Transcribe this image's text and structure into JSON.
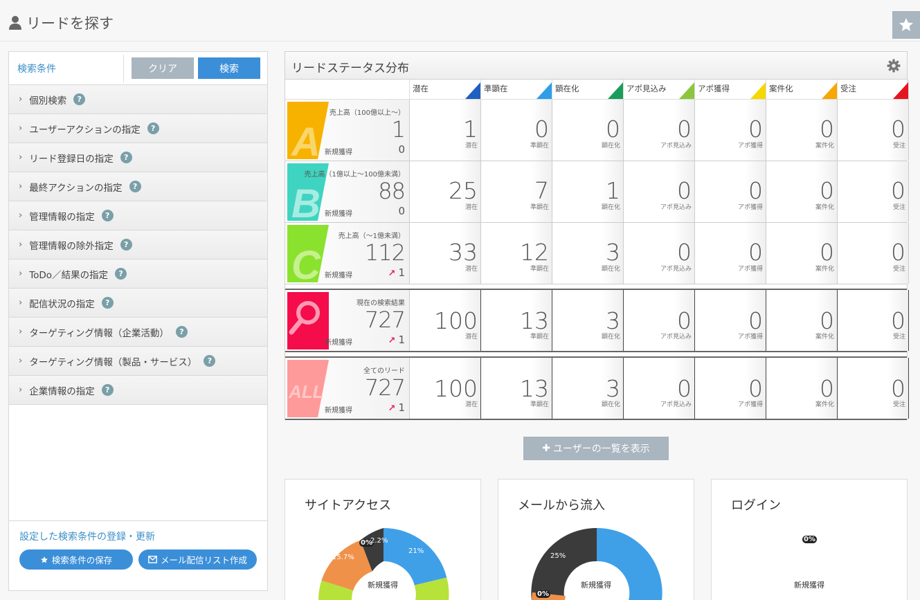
{
  "page": {
    "title": "リードを探す"
  },
  "search": {
    "label": "検索条件",
    "clear": "クリア",
    "search": "検索",
    "items": [
      "個別検索",
      "ユーザーアクションの指定",
      "リード登録日の指定",
      "最終アクションの指定",
      "管理情報の指定",
      "管理情報の除外指定",
      "ToDo／結果の指定",
      "配信状況の指定",
      "ターゲティング情報（企業活動）",
      "ターゲティング情報（製品・サービス）",
      "企業情報の指定"
    ],
    "help": "?",
    "footer_link": "設定した検索条件の登録・更新",
    "save": "検索条件の保存",
    "mail_list": "メール配信リスト作成"
  },
  "status": {
    "title": "リードステータス分布",
    "columns": [
      "潜在",
      "準顕在",
      "顕在化",
      "アポ見込み",
      "アポ獲得",
      "案件化",
      "受注"
    ],
    "column_colors": [
      "#1f5fbf",
      "#2e9ee6",
      "#1a9d5a",
      "#8cc63e",
      "#f5d800",
      "#f5a800",
      "#e6141e"
    ],
    "new_label": "新規獲得",
    "rows": [
      {
        "badge": "A",
        "badge_color": "#f7b200",
        "badge_text_color": "#f9d66a",
        "sub": "売上高（100億以上～）",
        "total": "1",
        "new": "0",
        "new_up": false,
        "values": [
          "1",
          "0",
          "0",
          "0",
          "0",
          "0",
          "0"
        ]
      },
      {
        "badge": "B",
        "badge_color": "#3fd4c1",
        "badge_text_color": "#a7ece2",
        "sub": "売上高（1億以上～100億未満）",
        "total": "88",
        "new": "0",
        "new_up": false,
        "values": [
          "25",
          "7",
          "1",
          "0",
          "0",
          "0",
          "0"
        ]
      },
      {
        "badge": "C",
        "badge_color": "#8ae22f",
        "badge_text_color": "#c6f18e",
        "sub": "売上高（～1億未満）",
        "total": "112",
        "new": "1",
        "new_up": true,
        "values": [
          "33",
          "12",
          "3",
          "0",
          "0",
          "0",
          "0"
        ]
      },
      {
        "badge": "search",
        "badge_color": "#f50c4a",
        "sub": "現在の検索結果",
        "total": "727",
        "new": "1",
        "new_up": true,
        "values": [
          "100",
          "13",
          "3",
          "0",
          "0",
          "0",
          "0"
        ]
      },
      {
        "badge": "ALL",
        "badge_color": "#ff9a9a",
        "badge_text_color": "#ffc7c7",
        "sub": "全てのリード",
        "total": "727",
        "new": "1",
        "new_up": true,
        "values": [
          "100",
          "13",
          "3",
          "0",
          "0",
          "0",
          "0"
        ]
      }
    ],
    "show_users": "ユーザーの一覧を表示",
    "up_arrow": "↗"
  },
  "cards": [
    {
      "title": "サイトアクセス",
      "center": "新規獲得",
      "labels": [
        "21%",
        "15.7%",
        "0%",
        "2.2%"
      ]
    },
    {
      "title": "メールから流入",
      "center": "新規獲得",
      "labels": [
        "25%",
        "0%"
      ]
    },
    {
      "title": "ログイン",
      "center": "新規獲得",
      "labels": [
        "0%"
      ]
    }
  ]
}
